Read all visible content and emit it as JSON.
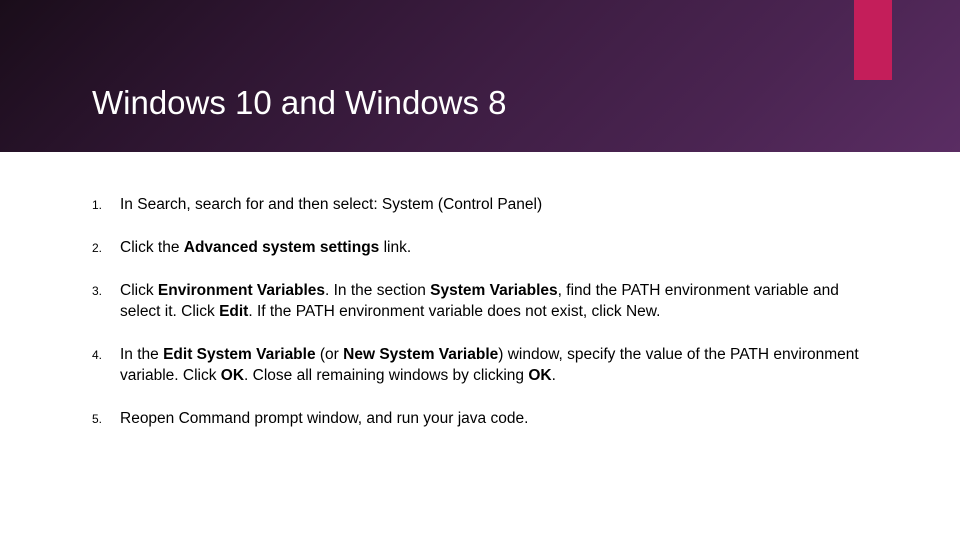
{
  "title": "Windows 10 and Windows 8",
  "items": [
    {
      "num": "1.",
      "segments": [
        {
          "t": "In Search, search for and then select: System (Control Panel)",
          "b": false
        }
      ]
    },
    {
      "num": "2.",
      "segments": [
        {
          "t": "Click the ",
          "b": false
        },
        {
          "t": "Advanced system settings",
          "b": true
        },
        {
          "t": " link.",
          "b": false
        }
      ]
    },
    {
      "num": "3.",
      "segments": [
        {
          "t": "Click ",
          "b": false
        },
        {
          "t": "Environment Variables",
          "b": true
        },
        {
          "t": ". In the section ",
          "b": false
        },
        {
          "t": "System Variables",
          "b": true
        },
        {
          "t": ", find the PATH environment variable and select it. Click ",
          "b": false
        },
        {
          "t": "Edit",
          "b": true
        },
        {
          "t": ". If the PATH environment variable does not exist, click New.",
          "b": false
        }
      ]
    },
    {
      "num": "4.",
      "segments": [
        {
          "t": "In the ",
          "b": false
        },
        {
          "t": "Edit System Variable",
          "b": true
        },
        {
          "t": " (or ",
          "b": false
        },
        {
          "t": "New System Variable",
          "b": true
        },
        {
          "t": ") window, specify the value of the PATH environment variable. Click ",
          "b": false
        },
        {
          "t": "OK",
          "b": true
        },
        {
          "t": ". Close all remaining windows by clicking ",
          "b": false
        },
        {
          "t": "OK",
          "b": true
        },
        {
          "t": ".",
          "b": false
        }
      ]
    },
    {
      "num": "5.",
      "segments": [
        {
          "t": "Reopen Command prompt window, and run your java code.",
          "b": false
        }
      ]
    }
  ]
}
